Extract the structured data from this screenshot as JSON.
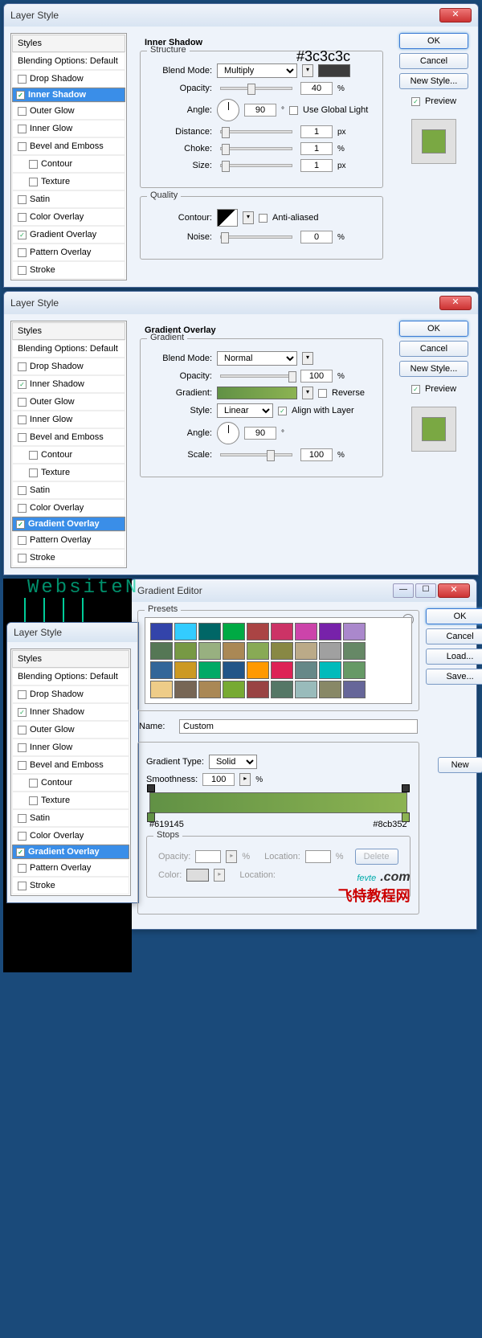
{
  "dlg1": {
    "title": "Layer Style",
    "sidebar": {
      "head": "Styles",
      "blend": "Blending Options: Default",
      "items": [
        {
          "label": "Drop Shadow",
          "on": false,
          "sel": false
        },
        {
          "label": "Inner Shadow",
          "on": true,
          "sel": true
        },
        {
          "label": "Outer Glow",
          "on": false,
          "sel": false
        },
        {
          "label": "Inner Glow",
          "on": false,
          "sel": false
        },
        {
          "label": "Bevel and Emboss",
          "on": false,
          "sel": false
        },
        {
          "label": "Contour",
          "on": false,
          "sel": false,
          "indent": true
        },
        {
          "label": "Texture",
          "on": false,
          "sel": false,
          "indent": true
        },
        {
          "label": "Satin",
          "on": false,
          "sel": false
        },
        {
          "label": "Color Overlay",
          "on": false,
          "sel": false
        },
        {
          "label": "Gradient Overlay",
          "on": true,
          "sel": false
        },
        {
          "label": "Pattern Overlay",
          "on": false,
          "sel": false
        },
        {
          "label": "Stroke",
          "on": false,
          "sel": false
        }
      ]
    },
    "panel": {
      "title": "Inner Shadow",
      "struct": "Structure",
      "annot": "#3c3c3c",
      "blendmode_l": "Blend Mode:",
      "blendmode": "Multiply",
      "swatch": "#3c3c3c",
      "opacity_l": "Opacity:",
      "opacity": "40",
      "opacity_u": "%",
      "angle_l": "Angle:",
      "angle": "90",
      "angle_u": "°",
      "global_l": "Use Global Light",
      "dist_l": "Distance:",
      "dist": "1",
      "dist_u": "px",
      "choke_l": "Choke:",
      "choke": "1",
      "choke_u": "%",
      "size_l": "Size:",
      "size": "1",
      "size_u": "px",
      "quality": "Quality",
      "contour_l": "Contour:",
      "aa_l": "Anti-aliased",
      "noise_l": "Noise:",
      "noise": "0",
      "noise_u": "%"
    },
    "buttons": {
      "ok": "OK",
      "cancel": "Cancel",
      "newstyle": "New Style...",
      "preview": "Preview"
    }
  },
  "dlg2": {
    "title": "Layer Style",
    "sidebar_sel": "Gradient Overlay",
    "panel": {
      "title": "Gradient Overlay",
      "grad": "Gradient",
      "blendmode_l": "Blend Mode:",
      "blendmode": "Normal",
      "opacity_l": "Opacity:",
      "opacity": "100",
      "opacity_u": "%",
      "gradient_l": "Gradient:",
      "reverse_l": "Reverse",
      "style_l": "Style:",
      "style": "Linear",
      "align_l": "Align with Layer",
      "angle_l": "Angle:",
      "angle": "90",
      "angle_u": "°",
      "scale_l": "Scale:",
      "scale": "100",
      "scale_u": "%"
    }
  },
  "dlg3": {
    "title": "Gradient Editor",
    "bgtext": "WebsiteN",
    "presets_l": "Presets",
    "presets": [
      "#34a",
      "#3cf",
      "#066",
      "#0a4",
      "#a44",
      "#c36",
      "#c4a",
      "#72a",
      "#a8c",
      "#575",
      "#794",
      "#98b080",
      "#a85",
      "#8a5",
      "#884",
      "#ba8",
      "#a0a0a0",
      "#686",
      "#369",
      "#c92",
      "#0a6",
      "#258",
      "#f90",
      "#d25",
      "#688",
      "#0bb",
      "#696",
      "#ec8",
      "#765",
      "#a85",
      "#7a3",
      "#944",
      "#576",
      "#9bb",
      "#886",
      "#669"
    ],
    "name_l": "Name:",
    "name": "Custom",
    "new_l": "New",
    "gtype_l": "Gradient Type:",
    "gtype": "Solid",
    "smooth_l": "Smoothness:",
    "smooth": "100",
    "smooth_u": "%",
    "hex1": "#619145",
    "hex2": "#8cb352",
    "stops_l": "Stops",
    "sop_l": "Opacity:",
    "sloc_l": "Location:",
    "scol_l": "Color:",
    "del_l": "Delete",
    "buttons": {
      "ok": "OK",
      "cancel": "Cancel",
      "load": "Load...",
      "save": "Save..."
    },
    "wm1a": "fevte",
    "wm1b": ".com",
    "wm2": "飞特教程网",
    "pct": "%"
  }
}
